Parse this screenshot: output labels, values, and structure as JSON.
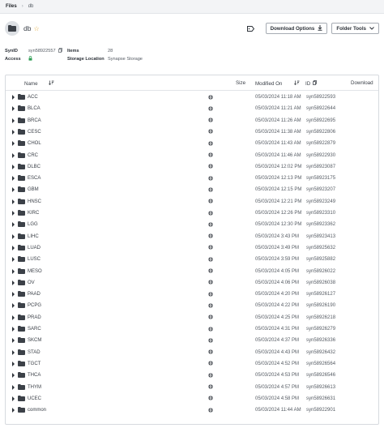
{
  "breadcrumb": {
    "root": "Files",
    "separator": "›",
    "current": "db"
  },
  "header": {
    "title": "db",
    "download_options_label": "Download Options",
    "folder_tools_label": "Folder Tools"
  },
  "meta": {
    "synid_label": "SynID",
    "synid_value": "syn58922557",
    "access_label": "Access",
    "items_label": "Items",
    "items_value": "28",
    "storage_label": "Storage Location",
    "storage_value": "Synapse Storage"
  },
  "table": {
    "columns": {
      "name": "Name",
      "size": "Size",
      "modified": "Modified On",
      "id": "ID",
      "download": "Download"
    },
    "rows": [
      {
        "name": "ACC",
        "modified": "05/03/2024 11:18 AM",
        "id": "syn58922593"
      },
      {
        "name": "BLCA",
        "modified": "05/03/2024 11:21 AM",
        "id": "syn58922644"
      },
      {
        "name": "BRCA",
        "modified": "05/03/2024 11:26 AM",
        "id": "syn58922695"
      },
      {
        "name": "CESC",
        "modified": "05/03/2024 11:38 AM",
        "id": "syn58922806"
      },
      {
        "name": "CHOL",
        "modified": "05/03/2024 11:43 AM",
        "id": "syn58922879"
      },
      {
        "name": "CRC",
        "modified": "05/03/2024 11:46 AM",
        "id": "syn58922930"
      },
      {
        "name": "DLBC",
        "modified": "05/03/2024 12:02 PM",
        "id": "syn58923087"
      },
      {
        "name": "ESCA",
        "modified": "05/03/2024 12:13 PM",
        "id": "syn58923175"
      },
      {
        "name": "GBM",
        "modified": "05/03/2024 12:15 PM",
        "id": "syn58923207"
      },
      {
        "name": "HNSC",
        "modified": "05/03/2024 12:21 PM",
        "id": "syn58923249"
      },
      {
        "name": "KIRC",
        "modified": "05/03/2024 12:26 PM",
        "id": "syn58923310"
      },
      {
        "name": "LGG",
        "modified": "05/03/2024 12:30 PM",
        "id": "syn58923362"
      },
      {
        "name": "LIHC",
        "modified": "05/03/2024 3:43 PM",
        "id": "syn58923413"
      },
      {
        "name": "LUAD",
        "modified": "05/03/2024 3:49 PM",
        "id": "syn58925632"
      },
      {
        "name": "LUSC",
        "modified": "05/03/2024 3:59 PM",
        "id": "syn58925882"
      },
      {
        "name": "MESO",
        "modified": "05/03/2024 4:05 PM",
        "id": "syn58926022"
      },
      {
        "name": "OV",
        "modified": "05/03/2024 4:06 PM",
        "id": "syn58926038"
      },
      {
        "name": "PAAD",
        "modified": "05/03/2024 4:20 PM",
        "id": "syn58926127"
      },
      {
        "name": "PCPG",
        "modified": "05/03/2024 4:22 PM",
        "id": "syn58926190"
      },
      {
        "name": "PRAD",
        "modified": "05/03/2024 4:25 PM",
        "id": "syn58926218"
      },
      {
        "name": "SARC",
        "modified": "05/03/2024 4:31 PM",
        "id": "syn58926279"
      },
      {
        "name": "SKCM",
        "modified": "05/03/2024 4:37 PM",
        "id": "syn58926336"
      },
      {
        "name": "STAD",
        "modified": "05/03/2024 4:43 PM",
        "id": "syn58926432"
      },
      {
        "name": "TGCT",
        "modified": "05/03/2024 4:52 PM",
        "id": "syn58926564"
      },
      {
        "name": "THCA",
        "modified": "05/03/2024 4:53 PM",
        "id": "syn58926546"
      },
      {
        "name": "THYM",
        "modified": "05/03/2024 4:57 PM",
        "id": "syn58926613"
      },
      {
        "name": "UCEC",
        "modified": "05/03/2024 4:58 PM",
        "id": "syn58926631"
      },
      {
        "name": "common",
        "modified": "05/03/2024 11:44 AM",
        "id": "syn58922901"
      }
    ]
  },
  "colors": {
    "folder": "#3c4148",
    "accent_star": "#e0a52c",
    "access_icon": "#2f9e55"
  }
}
